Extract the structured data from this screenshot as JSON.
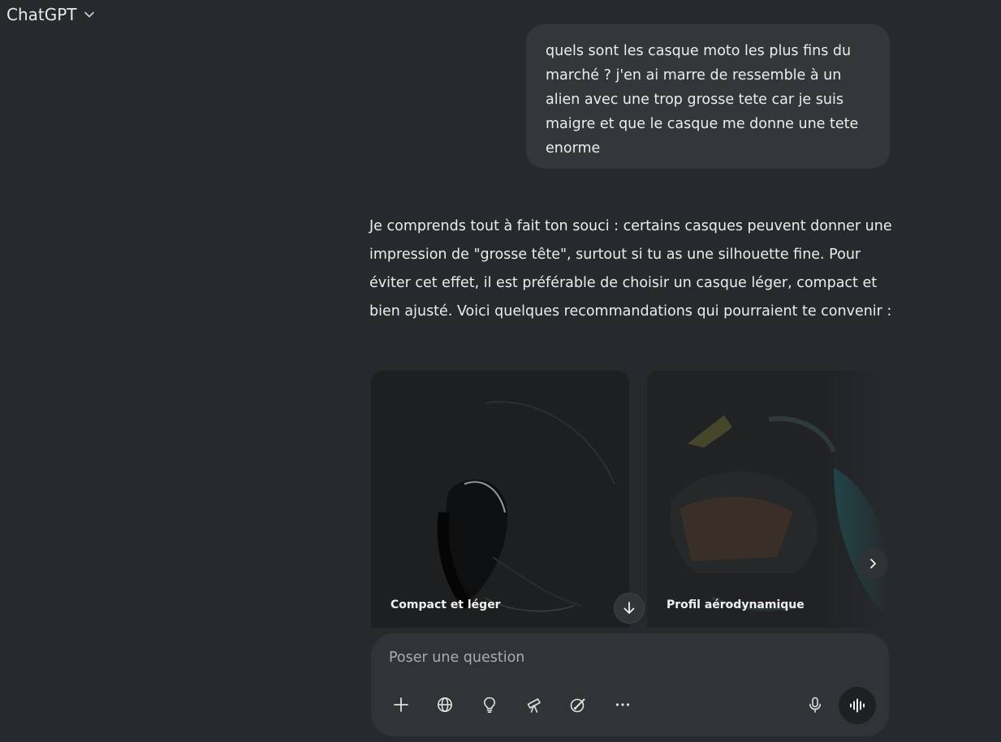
{
  "header": {
    "model_label": "ChatGPT",
    "icons": {
      "dropdown": "chevron-down-icon"
    }
  },
  "conversation": {
    "user_message": "quels sont les casque moto les plus fins du marché ? j'en ai marre de ressemble à un alien avec une trop grosse tete car je suis maigre et que le casque me donne une tete enorme",
    "assistant_message": "Je comprends tout à fait ton souci : certains casques peuvent donner une impression de \"grosse tête\", surtout si tu as une silhouette fine. Pour éviter cet effet, il est préférable de choisir un casque léger, compact et bien ajusté. Voici quelques recommandations qui pourraient te convenir :",
    "image_cards": [
      {
        "caption": "Compact et léger",
        "image": "helmet-photo"
      },
      {
        "caption": "Profil aérodynamique",
        "image": "helmet-photo"
      }
    ]
  },
  "composer": {
    "placeholder": "Poser une question",
    "tools": [
      "plus-icon",
      "globe-icon",
      "lightbulb-icon",
      "telescope-icon",
      "paintbrush-icon",
      "more-icon"
    ],
    "right_tools": [
      "microphone-icon",
      "voice-mode-icon"
    ]
  },
  "colors": {
    "background": "#272a2d",
    "bubble": "#343739",
    "composer": "#303437",
    "text": "#ececec",
    "placeholder": "#a9acaf"
  }
}
